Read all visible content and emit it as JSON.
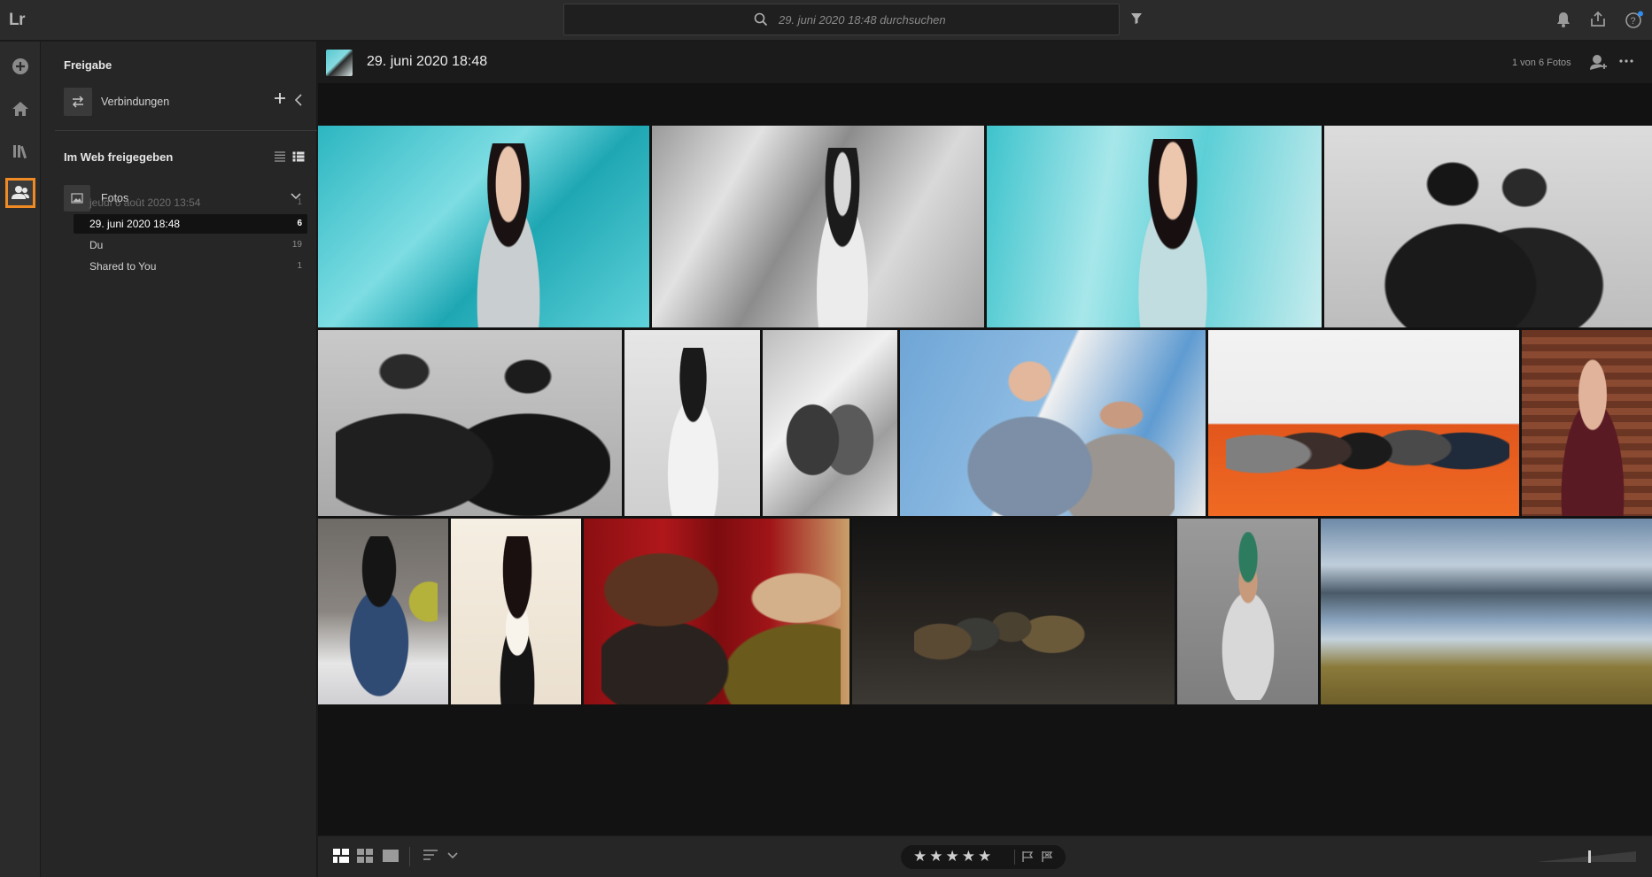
{
  "app": {
    "logo": "Lr"
  },
  "search": {
    "placeholder": "29. juni 2020 18:48 durchsuchen"
  },
  "panel": {
    "title": "Freigabe",
    "connections_label": "Verbindungen",
    "web_shared_title": "Im Web freigegeben",
    "folder_label": "Fotos",
    "albums": [
      {
        "name": "jeudi 6 août 2020 13:54",
        "count": "1"
      },
      {
        "name": "29. juni 2020 18:48",
        "count": "6"
      },
      {
        "name": "Du",
        "count": "19"
      },
      {
        "name": "Shared to You",
        "count": "1"
      }
    ]
  },
  "main": {
    "title": "29. juni 2020 18:48",
    "count_text": "1 von 6 Fotos"
  },
  "bottom": {
    "stars": "★★★★★"
  },
  "colors": {
    "accent": "#f08a24",
    "panel_bg": "#262626",
    "grid_bg": "#121212"
  },
  "icons": [
    "search-icon",
    "filter-icon",
    "bell-icon",
    "share-icon",
    "help-icon",
    "add-photo-icon",
    "home-icon",
    "library-icon",
    "shared-people-icon",
    "connections-icon",
    "add-icon",
    "collapse-icon",
    "list-view-icon",
    "detail-view-icon",
    "photos-folder-icon",
    "chevron-down-icon",
    "share-user-icon",
    "more-icon",
    "grid-view-icon",
    "square-grid-icon",
    "detail-single-icon",
    "sort-icon",
    "flag-icon",
    "reject-flag-icon",
    "zoom-slider-icon"
  ]
}
